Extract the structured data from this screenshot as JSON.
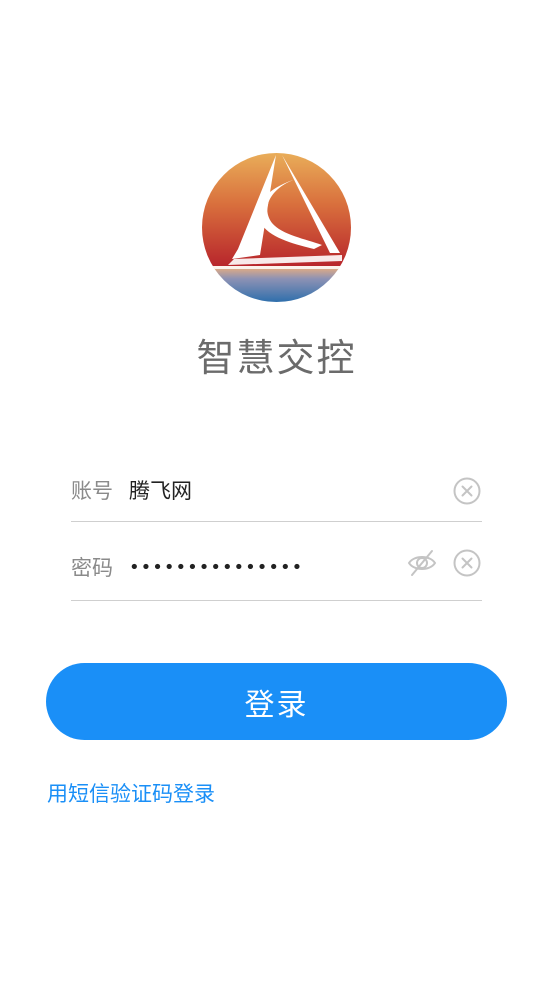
{
  "app": {
    "title": "智慧交控"
  },
  "form": {
    "account": {
      "label": "账号",
      "value": "腾飞网"
    },
    "password": {
      "label": "密码",
      "value": "•••••••••••••••",
      "visibility_icon": "eye-off-icon"
    },
    "clear_icon": "clear-icon"
  },
  "actions": {
    "login_label": "登录",
    "sms_login_label": "用短信验证码登录"
  },
  "colors": {
    "primary": "#1a8ff7",
    "title_gray": "#6b6b6b",
    "label_gray": "#8a8a8a",
    "divider": "#cfcfcf"
  }
}
